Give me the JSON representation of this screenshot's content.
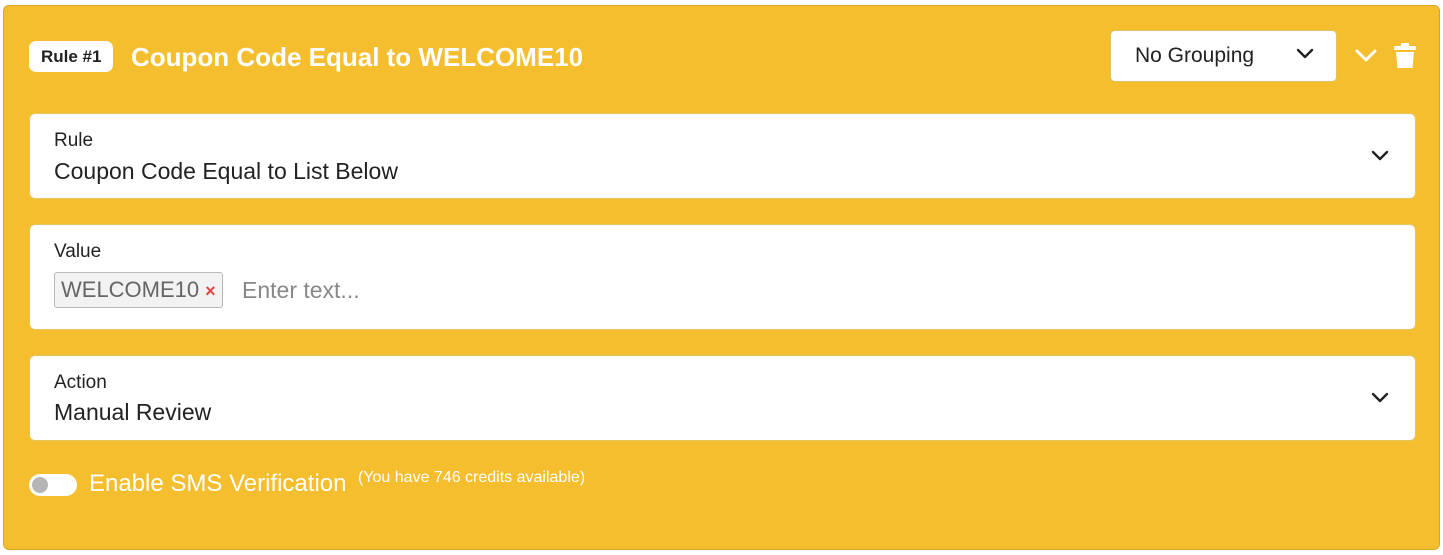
{
  "header": {
    "badge": "Rule #1",
    "title": "Coupon Code Equal to WELCOME10",
    "grouping_value": "No Grouping"
  },
  "rule_field": {
    "label": "Rule",
    "value": "Coupon Code Equal to List Below"
  },
  "value_field": {
    "label": "Value",
    "tags": [
      "WELCOME10"
    ],
    "tag_remove_glyph": "×",
    "placeholder": "Enter text..."
  },
  "action_field": {
    "label": "Action",
    "value": "Manual Review"
  },
  "sms": {
    "label": "Enable SMS Verification",
    "credits_note": "(You have 746 credits available)",
    "enabled": false
  },
  "colors": {
    "card_background": "#f4be2f",
    "tag_remove": "#e04747"
  },
  "icons": {
    "collapse": "chevron-down-icon",
    "delete": "trash-icon"
  }
}
